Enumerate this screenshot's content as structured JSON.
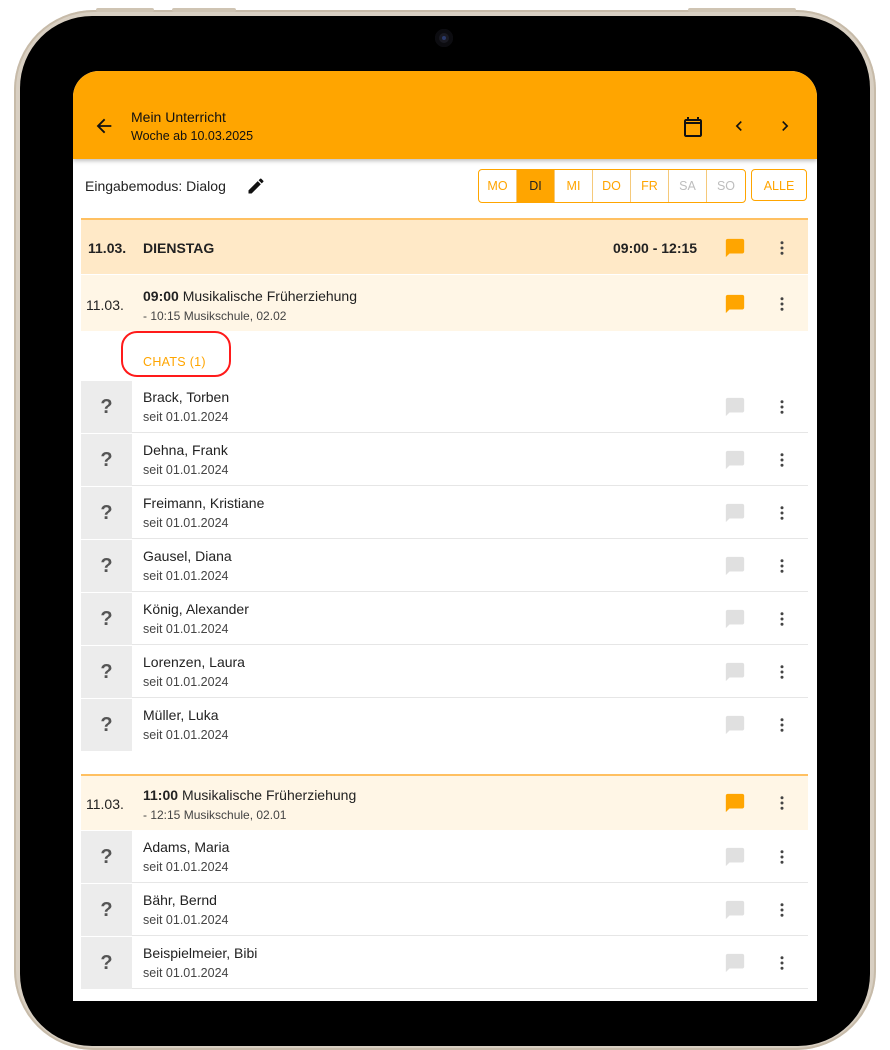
{
  "appbar": {
    "title": "Mein Unterricht",
    "subtitle": "Woche ab 10.03.2025",
    "accent": "#ffa500"
  },
  "mode": {
    "label": "Eingabemodus: Dialog",
    "days": [
      {
        "label": "MO",
        "state": "normal"
      },
      {
        "label": "DI",
        "state": "active"
      },
      {
        "label": "MI",
        "state": "normal"
      },
      {
        "label": "DO",
        "state": "normal"
      },
      {
        "label": "FR",
        "state": "normal"
      },
      {
        "label": "SA",
        "state": "disabled"
      },
      {
        "label": "SO",
        "state": "disabled"
      }
    ],
    "all_label": "ALLE"
  },
  "day_header": {
    "date": "11.03.",
    "weekday": "DIENSTAG",
    "time_range": "09:00 - 12:15"
  },
  "lessons": [
    {
      "date": "11.03.",
      "start": "09:00",
      "title": "Musikalische Früherziehung",
      "details": "- 10:15 Musikschule, 02.02",
      "chats_label": "CHATS (1)",
      "students": [
        {
          "name": "Brack, Torben",
          "since": "seit 01.01.2024",
          "avatar": "?"
        },
        {
          "name": "Dehna, Frank",
          "since": "seit 01.01.2024",
          "avatar": "?"
        },
        {
          "name": "Freimann, Kristiane",
          "since": "seit 01.01.2024",
          "avatar": "?"
        },
        {
          "name": "Gausel, Diana",
          "since": "seit 01.01.2024",
          "avatar": "?"
        },
        {
          "name": "König, Alexander",
          "since": "seit 01.01.2024",
          "avatar": "?"
        },
        {
          "name": "Lorenzen, Laura",
          "since": "seit 01.01.2024",
          "avatar": "?"
        },
        {
          "name": "Müller, Luka",
          "since": "seit 01.01.2024",
          "avatar": "?"
        }
      ]
    },
    {
      "date": "11.03.",
      "start": "11:00",
      "title": "Musikalische Früherziehung",
      "details": "- 12:15 Musikschule, 02.01",
      "students": [
        {
          "name": "Adams, Maria",
          "since": "seit 01.01.2024",
          "avatar": "?"
        },
        {
          "name": "Bähr, Bernd",
          "since": "seit 01.01.2024",
          "avatar": "?"
        },
        {
          "name": "Beispielmeier, Bibi",
          "since": "seit 01.01.2024",
          "avatar": "?"
        }
      ]
    }
  ],
  "icons": {
    "back": "arrow-left-icon",
    "calendar": "calendar-icon",
    "prev": "chevron-left-icon",
    "next": "chevron-right-icon",
    "edit": "pencil-icon",
    "chat": "chat-bubble-icon",
    "more": "more-vert-icon"
  },
  "colors": {
    "accent": "#ffa500",
    "day_header_bg": "#ffe9c7",
    "lesson_bg": "#fff6e6",
    "chat_inactive": "#e0e0e0",
    "highlight_ring": "#ff1a1a"
  }
}
